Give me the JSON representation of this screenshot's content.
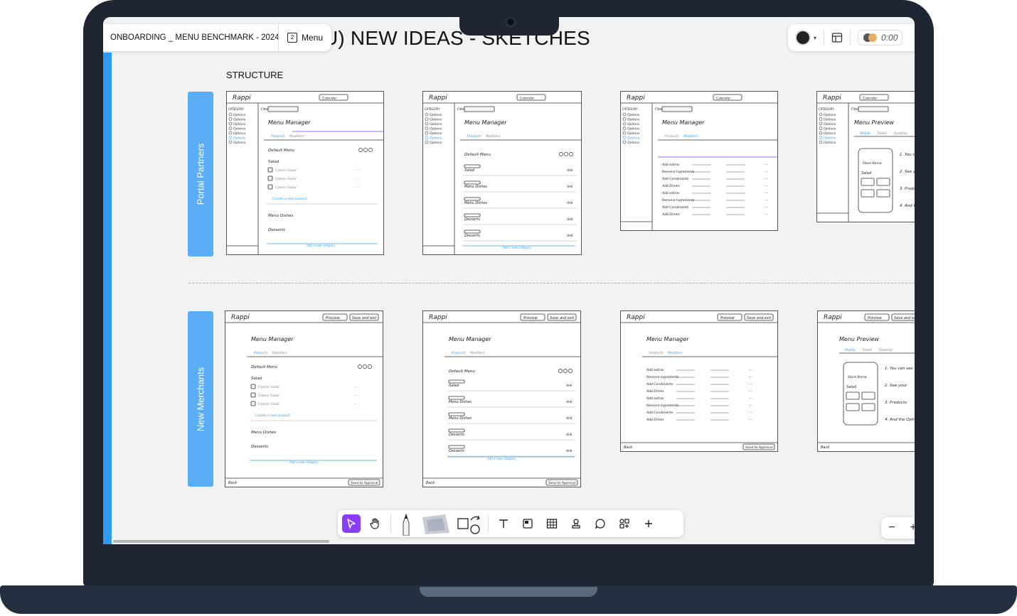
{
  "header": {
    "doc_name": "ONBOARDING _ MENU BENCHMARK - 2024",
    "menu_label": "Menu",
    "menu_badge": "2",
    "board_title": "U) NEW IDEAS - SKETCHES",
    "timer": "0:00"
  },
  "section": {
    "label": "STRUCTURE"
  },
  "rows": [
    {
      "label": "Portal Partners"
    },
    {
      "label": "New Merchants"
    }
  ],
  "sketch_text": {
    "logo": "Rappi",
    "menu_manager": "Menu Manager",
    "menu_preview": "Menu Preview",
    "default_menu": "Default Menu",
    "calendar": "Calendar",
    "categories": "CATEGORY",
    "filter": "Filter:",
    "preview": "Preview",
    "save_and_exit": "Save and exit",
    "back": "Back",
    "send_to_approval": "Send to Approval",
    "add_category": "Add a new category",
    "create_product": "Create a new product",
    "store_name": "Store Name",
    "options": [
      "Options",
      "Options",
      "Options",
      "Options",
      "Options",
      "Options",
      "Options"
    ],
    "categories_list": [
      "Salad",
      "Menu Dishes",
      "Desserts"
    ],
    "products": [
      "Caesar Salad",
      "Caesar Salad",
      "Caesar Salad"
    ],
    "tabs": [
      "Products",
      "Modifiers"
    ],
    "preview_tabs": [
      "Mobile",
      "Tablet",
      "Desktop"
    ],
    "table_rows": [
      "Add extras",
      "Remove Ingredients",
      "Add Condiments",
      "Add Drinks",
      "Add extras",
      "Remove Ingredients",
      "Add Condiments",
      "Add Drinks"
    ],
    "notes": [
      "1. You can see",
      "2. See your",
      "3. Products",
      "4. And the Options"
    ]
  },
  "toolbar": {
    "tools": [
      "select-tool",
      "hand-tool",
      "pen-tool",
      "sticky-note-tool",
      "shape-tool",
      "text-tool",
      "frame-tool",
      "table-tool",
      "stamp-tool",
      "comment-tool",
      "components-tool",
      "add-tool"
    ]
  },
  "zoom": {
    "minus": "−",
    "plus": "+"
  },
  "colors": {
    "accent_blue": "#2f9cf2",
    "label_blue": "#5aaef6",
    "purple": "#8b3dff",
    "sticky_purple": "#cfa9ff"
  }
}
